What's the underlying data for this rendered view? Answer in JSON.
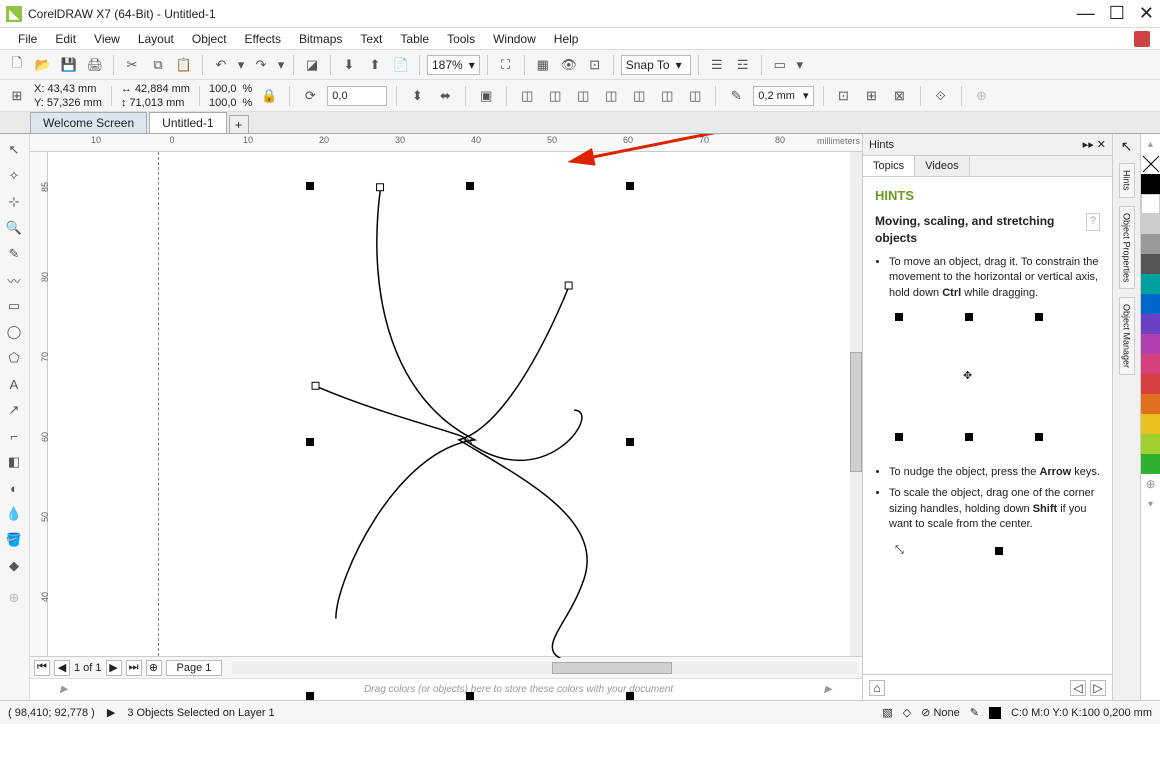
{
  "title": "CorelDRAW X7 (64-Bit) - Untitled-1",
  "menus": [
    "File",
    "Edit",
    "View",
    "Layout",
    "Object",
    "Effects",
    "Bitmaps",
    "Text",
    "Table",
    "Tools",
    "Window",
    "Help"
  ],
  "zoom": "187%",
  "snap": "Snap To",
  "coords": {
    "x": "X: 43,43 mm",
    "y": "Y: 57,326 mm"
  },
  "size": {
    "w": "42,884 mm",
    "h": "71,013 mm"
  },
  "scale": {
    "sx": "100,0",
    "sy": "100,0",
    "unit": "%"
  },
  "rotate": "0,0",
  "outline": "0,2 mm",
  "tabs": {
    "welcome": "Welcome Screen",
    "doc": "Untitled-1"
  },
  "ruler_unit": "millimeters",
  "pagenav": {
    "counter": "1 of 1",
    "page": "Page 1"
  },
  "colortray_hint": "Drag colors (or objects) here to store these colors with your document",
  "hints": {
    "panel_title": "Hints",
    "tabs": {
      "topics": "Topics",
      "videos": "Videos"
    },
    "title": "HINTS",
    "subtitle": "Moving, scaling, and stretching objects",
    "tip1_a": "To move an object, drag it. To constrain the movement to the horizontal or vertical axis, hold down ",
    "tip1_b": "Ctrl",
    "tip1_c": " while dragging.",
    "tip2_a": "To nudge the object, press the ",
    "tip2_b": "Arrow",
    "tip2_c": " keys.",
    "tip3_a": "To scale the object, drag one of the corner sizing handles, holding down ",
    "tip3_b": "Shift",
    "tip3_c": " if you want to scale from the center."
  },
  "side_tabs": [
    "Hints",
    "Object Properties",
    "Object Manager"
  ],
  "palette": [
    "none",
    "#000000",
    "#ffffff",
    "#cccccc",
    "#999999",
    "#555555",
    "#9a7b4f",
    "#c06e00",
    "#d0c080",
    "#e8d060",
    "#f0e020",
    "#f07c00",
    "#f02000",
    "#c0006b",
    "#a030e0",
    "#5050f0",
    "#00a0f0",
    "#00d0d0",
    "#00a050",
    "#60c030"
  ],
  "status": {
    "cursor": "( 98,410; 92,778 )",
    "selection": "3 Objects Selected on Layer 1",
    "fill": "None",
    "outline_info": "C:0 M:0 Y:0 K:100  0,200 mm"
  }
}
